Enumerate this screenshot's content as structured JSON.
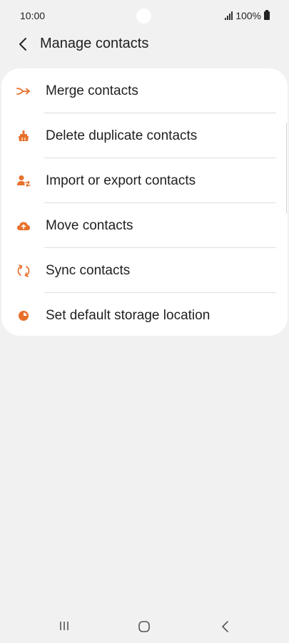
{
  "status_bar": {
    "time": "10:00",
    "battery": "100%"
  },
  "header": {
    "title": "Manage contacts",
    "back_icon": "chevron-left-icon"
  },
  "accent_color": "#e8702a",
  "menu": {
    "items": [
      {
        "label": "Merge contacts",
        "icon": "merge-icon"
      },
      {
        "label": "Delete duplicate contacts",
        "icon": "delete-duplicates-icon"
      },
      {
        "label": "Import or export contacts",
        "icon": "import-export-icon"
      },
      {
        "label": "Move contacts",
        "icon": "cloud-upload-icon"
      },
      {
        "label": "Sync contacts",
        "icon": "sync-icon"
      },
      {
        "label": "Set default storage location",
        "icon": "storage-pie-icon"
      }
    ]
  },
  "nav_bar": {
    "recent_icon": "recent-apps-icon",
    "home_icon": "home-icon",
    "back_icon": "back-icon"
  }
}
